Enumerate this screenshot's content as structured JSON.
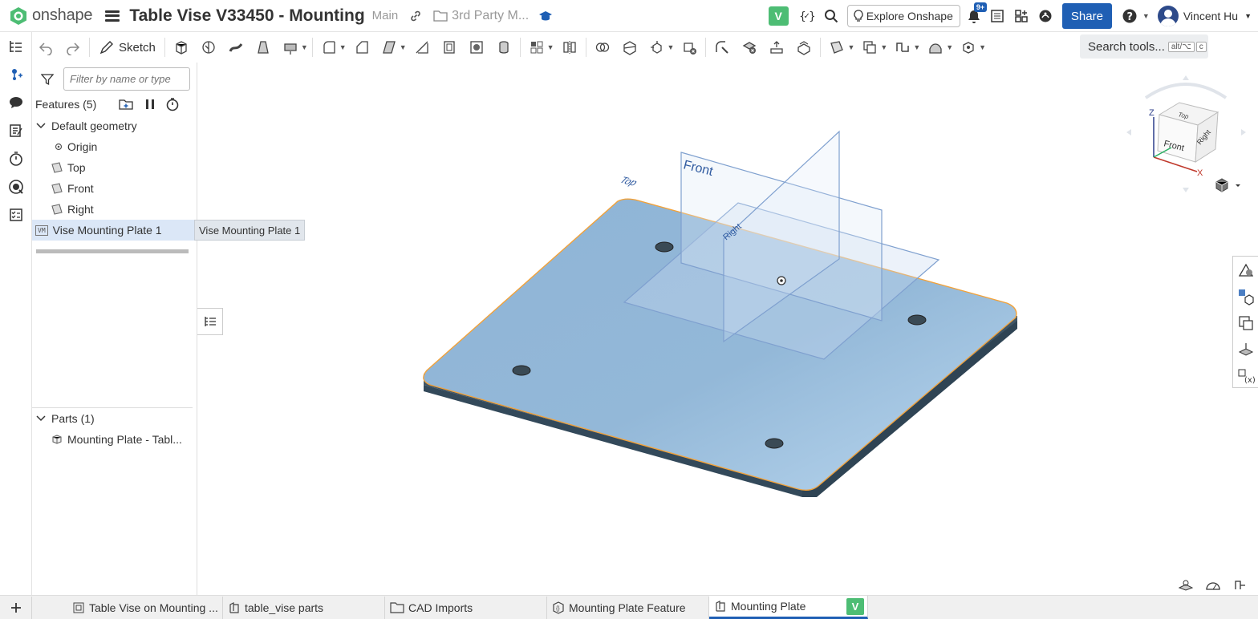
{
  "app": {
    "logo_text": "onshape",
    "brand_color": "#4dbd74",
    "accent_color": "#1f5fb4"
  },
  "header": {
    "doc_title": "Table Vise V33450 - Mounting",
    "branch": "Main",
    "folder": "3rd Party M...",
    "version_badge": "V",
    "explore_label": "Explore Onshape",
    "notifications_badge": "9+",
    "share_label": "Share",
    "user_name": "Vincent Hu"
  },
  "toolbar": {
    "sketch_label": "Sketch",
    "search_placeholder": "Search tools...",
    "search_shortcut_1": "alt/⌥",
    "search_shortcut_2": "c"
  },
  "feature_panel": {
    "filter_placeholder": "Filter by name or type",
    "features_header": "Features (5)",
    "default_geometry": "Default geometry",
    "items": [
      {
        "label": "Origin",
        "icon": "origin-icon"
      },
      {
        "label": "Top",
        "icon": "plane-icon"
      },
      {
        "label": "Front",
        "icon": "plane-icon"
      },
      {
        "label": "Right",
        "icon": "plane-icon"
      }
    ],
    "selected_feature": "Vise Mounting Plate 1",
    "selected_feature_icon_text": "VM",
    "tooltip": "Vise Mounting Plate 1",
    "parts_header": "Parts (1)",
    "parts": [
      {
        "label": "Mounting Plate - Tabl...",
        "icon": "part-icon"
      }
    ]
  },
  "viewport": {
    "plane_labels": {
      "front": "Front",
      "top": "Top",
      "right": "Right"
    },
    "view_cube": {
      "front": "Front",
      "top": "Top",
      "right": "Right",
      "axis_x": "X",
      "axis_z": "Z"
    }
  },
  "tabs": [
    {
      "label": "Table Vise on Mounting ...",
      "icon": "assembly-icon"
    },
    {
      "label": "table_vise parts",
      "icon": "partstudio-icon"
    },
    {
      "label": "CAD Imports",
      "icon": "folder-icon"
    },
    {
      "label": "Mounting Plate Feature",
      "icon": "featurestudio-icon"
    },
    {
      "label": "Mounting Plate",
      "icon": "partstudio-icon",
      "active": true,
      "badge": "V"
    }
  ]
}
